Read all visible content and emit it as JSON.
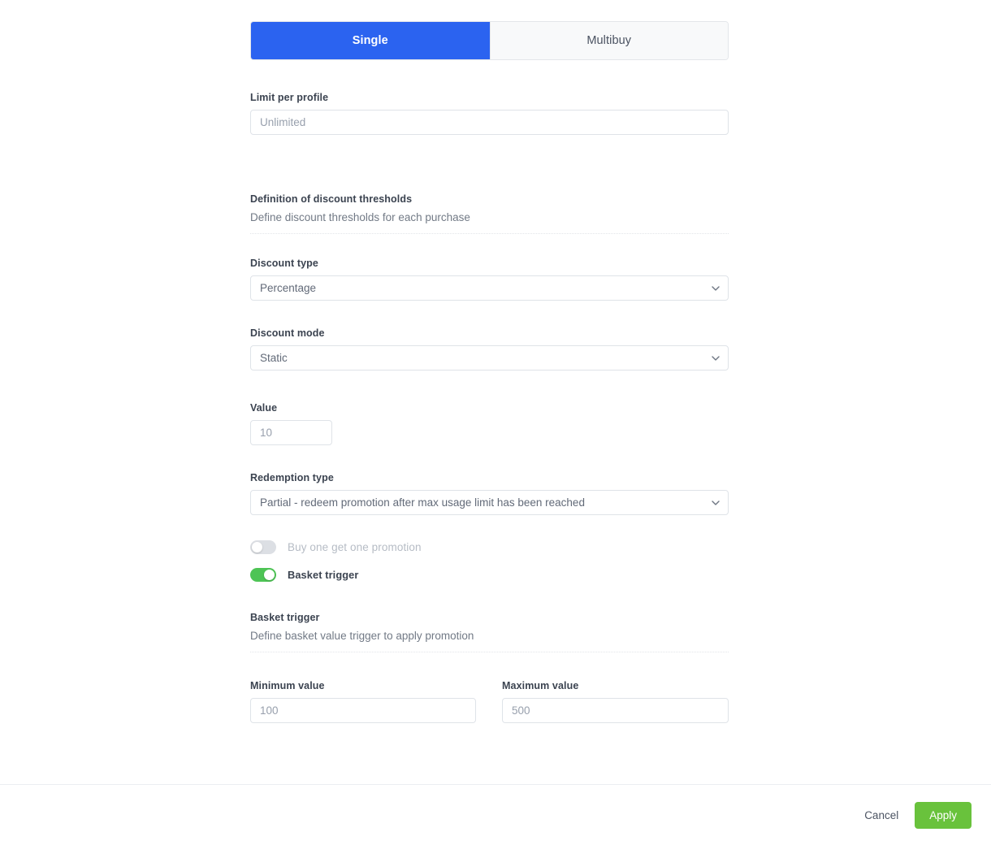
{
  "tabs": [
    {
      "label": "Single",
      "active": true
    },
    {
      "label": "Multibuy",
      "active": false
    }
  ],
  "limit_per_profile": {
    "label": "Limit per profile",
    "placeholder": "Unlimited",
    "value": ""
  },
  "thresholds_section": {
    "title": "Definition of discount thresholds",
    "subtitle": "Define discount thresholds for each purchase"
  },
  "discount_type": {
    "label": "Discount type",
    "value": "Percentage",
    "icon": "chevron-down-icon"
  },
  "discount_mode": {
    "label": "Discount mode",
    "value": "Static",
    "icon": "chevron-down-icon"
  },
  "value_field": {
    "label": "Value",
    "value": "10"
  },
  "redemption_type": {
    "label": "Redemption type",
    "value": "Partial - redeem promotion after max usage limit has been reached",
    "icon": "chevron-down-icon"
  },
  "toggles": [
    {
      "label": "Buy one get one promotion",
      "on": false
    },
    {
      "label": "Basket trigger",
      "on": true
    }
  ],
  "basket_section": {
    "title": "Basket trigger",
    "subtitle": "Define basket value trigger to apply promotion"
  },
  "minimum_value": {
    "label": "Minimum value",
    "value": "100"
  },
  "maximum_value": {
    "label": "Maximum value",
    "value": "500"
  },
  "footer": {
    "cancel_label": "Cancel",
    "apply_label": "Apply"
  },
  "colors": {
    "tab_active": "#2b63f0",
    "toggle_on": "#4ec455",
    "apply_button": "#69c23c",
    "label_text": "#3b4350",
    "placeholder_text": "#98a0ad"
  }
}
